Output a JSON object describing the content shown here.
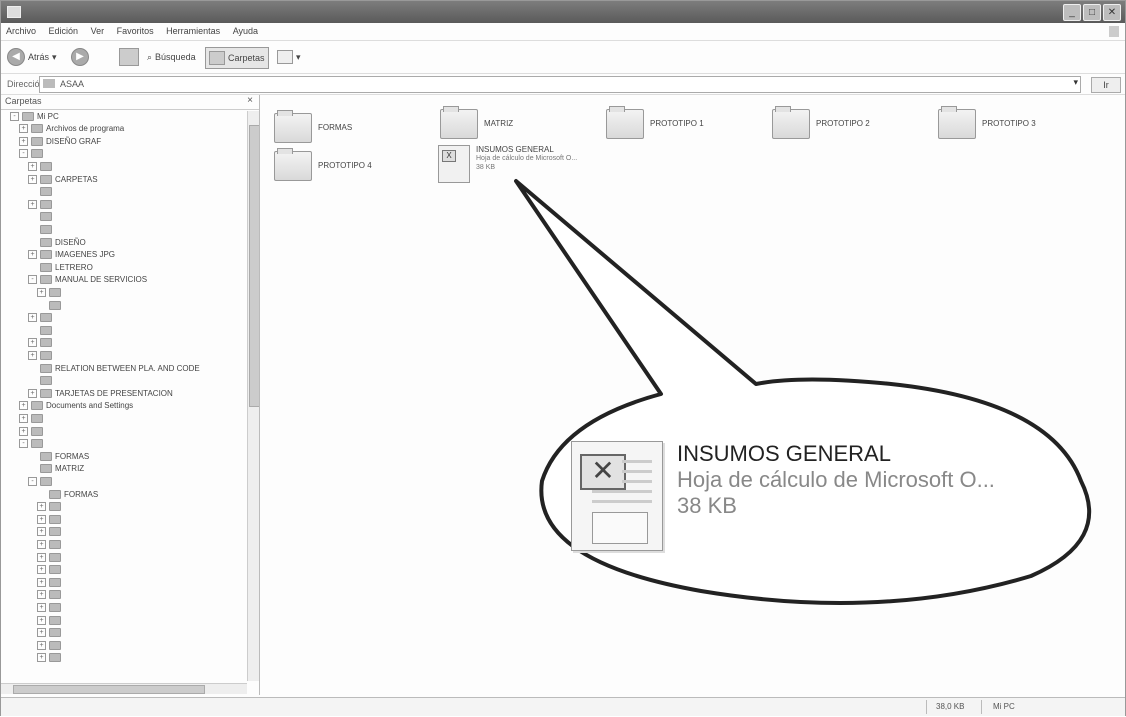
{
  "window": {
    "title": ""
  },
  "menubar": {
    "items": [
      "Archivo",
      "Edición",
      "Ver",
      "Favoritos",
      "Herramientas",
      "Ayuda"
    ]
  },
  "toolbar": {
    "back_label": "Atrás",
    "search_label": "Búsqueda",
    "folders_label": "Carpetas"
  },
  "address": {
    "label": "Dirección",
    "value": "ASAA",
    "go_label": "Ir"
  },
  "sidebar": {
    "title": "Carpetas",
    "tree": [
      {
        "indent": 1,
        "pm": "-",
        "label": "Mi PC"
      },
      {
        "indent": 2,
        "pm": "+",
        "label": "Archivos de programa"
      },
      {
        "indent": 2,
        "pm": "+",
        "label": "DISEÑO GRAF"
      },
      {
        "indent": 2,
        "pm": "-",
        "label": ""
      },
      {
        "indent": 3,
        "pm": "+",
        "label": ""
      },
      {
        "indent": 3,
        "pm": "+",
        "label": "CARPETAS"
      },
      {
        "indent": 3,
        "pm": "",
        "label": ""
      },
      {
        "indent": 3,
        "pm": "+",
        "label": ""
      },
      {
        "indent": 3,
        "pm": "",
        "label": ""
      },
      {
        "indent": 3,
        "pm": "",
        "label": ""
      },
      {
        "indent": 3,
        "pm": "",
        "label": "DISEÑO"
      },
      {
        "indent": 3,
        "pm": "+",
        "label": "IMAGENES JPG"
      },
      {
        "indent": 3,
        "pm": "",
        "label": "LETRERO"
      },
      {
        "indent": 3,
        "pm": "-",
        "label": "MANUAL DE SERVICIOS"
      },
      {
        "indent": 4,
        "pm": "+",
        "label": ""
      },
      {
        "indent": 4,
        "pm": "",
        "label": ""
      },
      {
        "indent": 3,
        "pm": "+",
        "label": ""
      },
      {
        "indent": 3,
        "pm": "",
        "label": ""
      },
      {
        "indent": 3,
        "pm": "+",
        "label": ""
      },
      {
        "indent": 3,
        "pm": "+",
        "label": ""
      },
      {
        "indent": 3,
        "pm": "",
        "label": "RELATION BETWEEN PLA. AND CODE"
      },
      {
        "indent": 3,
        "pm": "",
        "label": ""
      },
      {
        "indent": 3,
        "pm": "+",
        "label": "TARJETAS DE PRESENTACION"
      },
      {
        "indent": 2,
        "pm": "+",
        "label": "Documents and Settings"
      },
      {
        "indent": 2,
        "pm": "+",
        "label": ""
      },
      {
        "indent": 2,
        "pm": "+",
        "label": ""
      },
      {
        "indent": 2,
        "pm": "-",
        "label": ""
      },
      {
        "indent": 3,
        "pm": "",
        "label": "FORMAS"
      },
      {
        "indent": 3,
        "pm": "",
        "label": "MATRIZ"
      },
      {
        "indent": 3,
        "pm": "-",
        "label": ""
      },
      {
        "indent": 4,
        "pm": "",
        "label": "FORMAS"
      },
      {
        "indent": 4,
        "pm": "+",
        "label": ""
      },
      {
        "indent": 4,
        "pm": "+",
        "label": ""
      },
      {
        "indent": 4,
        "pm": "+",
        "label": ""
      },
      {
        "indent": 4,
        "pm": "+",
        "label": ""
      },
      {
        "indent": 4,
        "pm": "+",
        "label": ""
      },
      {
        "indent": 4,
        "pm": "+",
        "label": ""
      },
      {
        "indent": 4,
        "pm": "+",
        "label": ""
      },
      {
        "indent": 4,
        "pm": "+",
        "label": ""
      },
      {
        "indent": 4,
        "pm": "+",
        "label": ""
      },
      {
        "indent": 4,
        "pm": "+",
        "label": ""
      },
      {
        "indent": 4,
        "pm": "+",
        "label": ""
      },
      {
        "indent": 4,
        "pm": "+",
        "label": ""
      },
      {
        "indent": 4,
        "pm": "+",
        "label": ""
      }
    ]
  },
  "main": {
    "folders": [
      {
        "label": "FORMAS"
      },
      {
        "label": "MATRIZ"
      },
      {
        "label": "PROTOTIPO 1"
      },
      {
        "label": "PROTOTIPO 2"
      },
      {
        "label": "PROTOTIPO 3"
      },
      {
        "label": "PROTOTIPO 4"
      }
    ],
    "file": {
      "name": "INSUMOS GENERAL",
      "type": "Hoja de cálculo de Microsoft O...",
      "size": "38 KB"
    }
  },
  "callout": {
    "name": "INSUMOS GENERAL",
    "type": "Hoja de cálculo de Microsoft O...",
    "size": "38 KB",
    "icon": "excel-spreadsheet-icon"
  },
  "statusbar": {
    "left": "",
    "size": "38,0 KB",
    "zone": "Mi PC"
  }
}
